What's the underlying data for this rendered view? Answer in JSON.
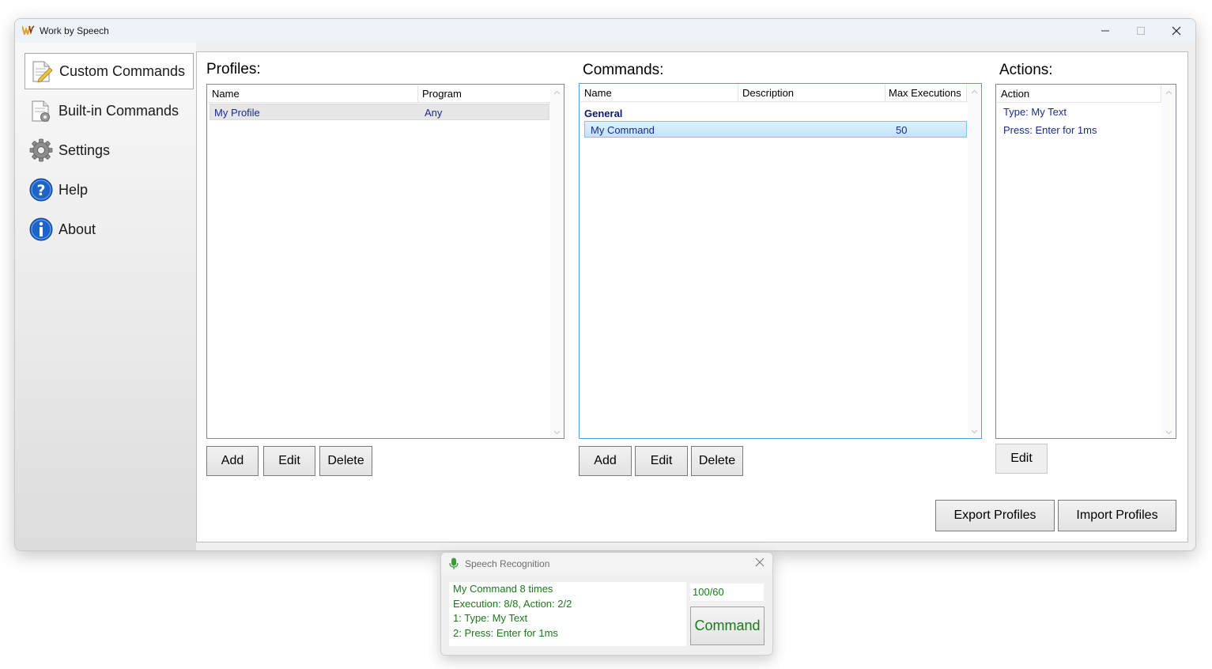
{
  "window": {
    "title": "Work by Speech"
  },
  "sidebar": {
    "items": [
      {
        "label": "Custom Commands",
        "icon": "document-pencil-icon",
        "active": true
      },
      {
        "label": "Built-in Commands",
        "icon": "document-gear-icon",
        "active": false
      },
      {
        "label": "Settings",
        "icon": "gear-icon",
        "active": false
      },
      {
        "label": "Help",
        "icon": "question-icon",
        "active": false
      },
      {
        "label": "About",
        "icon": "info-icon",
        "active": false
      }
    ]
  },
  "profiles": {
    "title": "Profiles:",
    "columns": [
      "Name",
      "Program"
    ],
    "rows": [
      {
        "name": "My Profile",
        "program": "Any"
      }
    ],
    "buttons": {
      "add": "Add",
      "edit": "Edit",
      "delete": "Delete"
    }
  },
  "commands": {
    "title": "Commands:",
    "columns": [
      "Name",
      "Description",
      "Max Executions"
    ],
    "group": "General",
    "rows": [
      {
        "name": "My Command",
        "description": "",
        "max_executions": "50"
      }
    ],
    "buttons": {
      "add": "Add",
      "edit": "Edit",
      "delete": "Delete"
    }
  },
  "actions": {
    "title": "Actions:",
    "columns": [
      "Action"
    ],
    "rows": [
      "Type: My Text",
      "Press: Enter for 1ms"
    ],
    "buttons": {
      "edit": "Edit"
    }
  },
  "footer": {
    "export": "Export Profiles",
    "import": "Import Profiles"
  },
  "speech": {
    "title": "Speech Recognition",
    "log": [
      "My Command 8 times",
      "Execution: 8/8, Action: 2/2",
      "1: Type: My Text",
      "2: Press: Enter for 1ms"
    ],
    "counter": "100/60",
    "button": "Command"
  },
  "colors": {
    "log_text": "#1a7a1a",
    "selection_blue": "#c2e4f8",
    "group_header": "#0d1a6e"
  }
}
